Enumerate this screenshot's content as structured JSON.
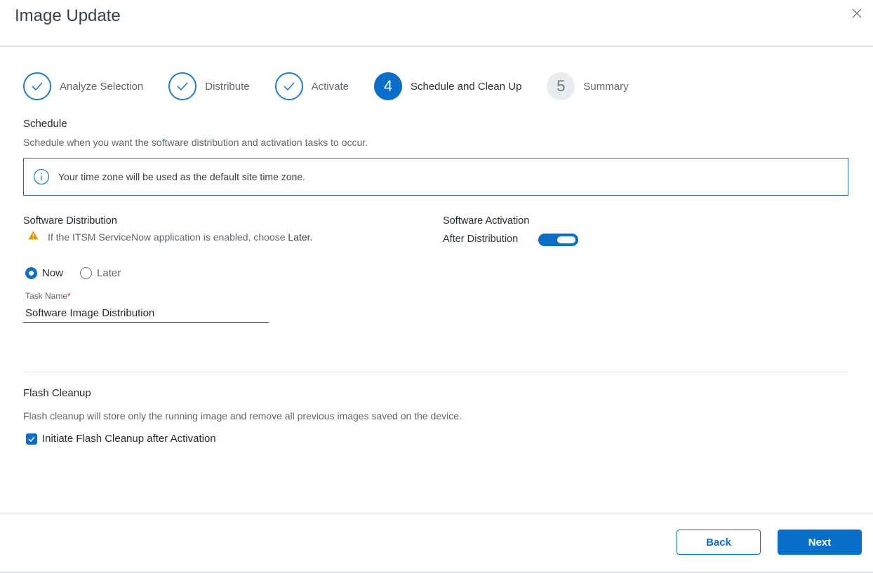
{
  "dialog": {
    "title": "Image Update"
  },
  "stepper": {
    "steps": [
      {
        "label": "Analyze Selection",
        "state": "done"
      },
      {
        "label": "Distribute",
        "state": "done"
      },
      {
        "label": "Activate",
        "state": "done"
      },
      {
        "label": "Schedule and Clean Up",
        "state": "active",
        "number": "4"
      },
      {
        "label": "Summary",
        "state": "pending",
        "number": "5"
      }
    ]
  },
  "schedule": {
    "title": "Schedule",
    "description": "Schedule when you want the software distribution and activation tasks to occur.",
    "info_message": "Your time zone will be used as the default site time zone."
  },
  "distribution": {
    "title": "Software Distribution",
    "warning_prefix": "If the ITSM ServiceNow application is enabled, choose ",
    "warning_emphasis": "Later.",
    "options": [
      {
        "label": "Now",
        "selected": true
      },
      {
        "label": "Later",
        "selected": false
      }
    ],
    "task_name_label": "Task Name",
    "task_name_required_mark": "*",
    "task_name_value": "Software Image Distribution"
  },
  "activation": {
    "title": "Software Activation",
    "toggle_label": "After Distribution",
    "toggle_on": true
  },
  "flash_cleanup": {
    "title": "Flash Cleanup",
    "description": "Flash cleanup will store only the running image and remove all previous images saved on the device.",
    "checkbox_label": "Initiate Flash Cleanup after Activation",
    "checked": true
  },
  "footer": {
    "back_label": "Back",
    "next_label": "Next"
  },
  "colors": {
    "primary": "#0a6ecb",
    "warning": "#d99a00"
  },
  "icons": {
    "close": "close-icon",
    "check": "check-icon",
    "info": "info-icon",
    "warning": "warning-icon"
  }
}
